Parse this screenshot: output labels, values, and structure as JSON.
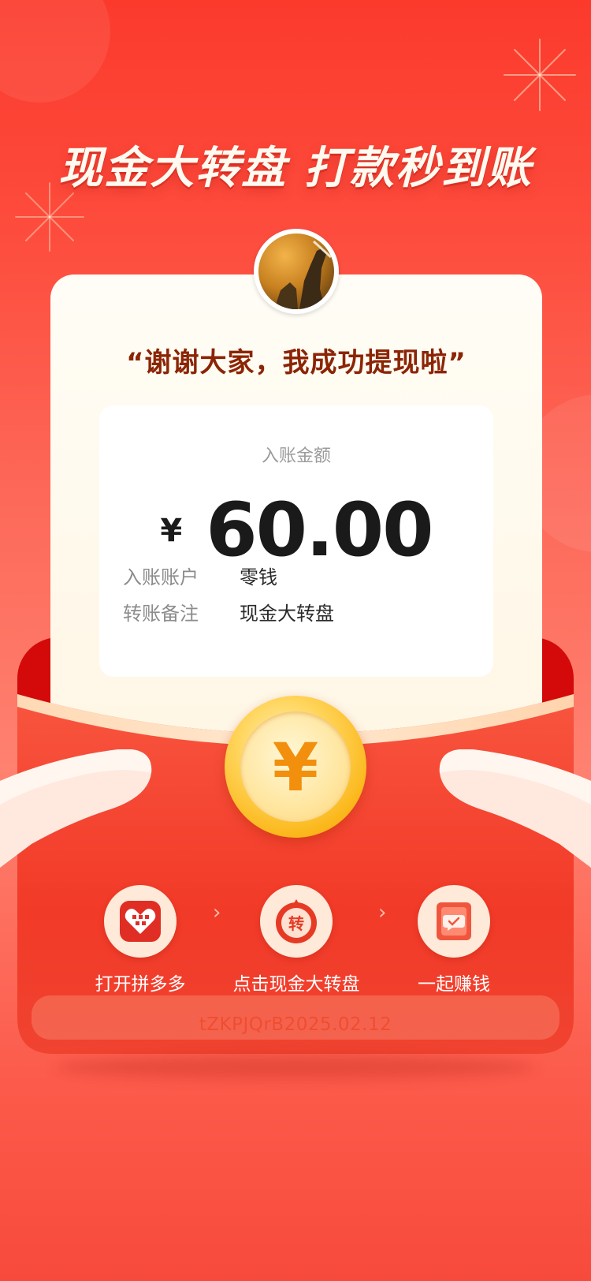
{
  "headline": "现金大转盘 打款秒到账",
  "quote": "“谢谢大家，我成功提现啦”",
  "receipt": {
    "amount_label": "入账金额",
    "currency_symbol": "¥",
    "amount": "60.00",
    "rows": [
      {
        "key": "入账账户",
        "value": "零钱"
      },
      {
        "key": "转账备注",
        "value": "现金大转盘"
      }
    ]
  },
  "coin_symbol": "¥",
  "steps": [
    {
      "label": "打开拼多多",
      "icon": "pinduoduo-app-icon",
      "badge": "拼"
    },
    {
      "label": "点击现金大转盘",
      "icon": "lucky-wheel-icon",
      "badge": "转"
    },
    {
      "label": "一起赚钱",
      "icon": "chat-bubble-icon"
    }
  ],
  "step_arrow": "›",
  "code": "tZKPJQrB2025.02.12",
  "colors": {
    "background": "#fd4c3d",
    "envelope": "#f23a28",
    "envelope_back": "#d30a09",
    "quote": "#8b2506",
    "coin": "#fbb81c"
  }
}
